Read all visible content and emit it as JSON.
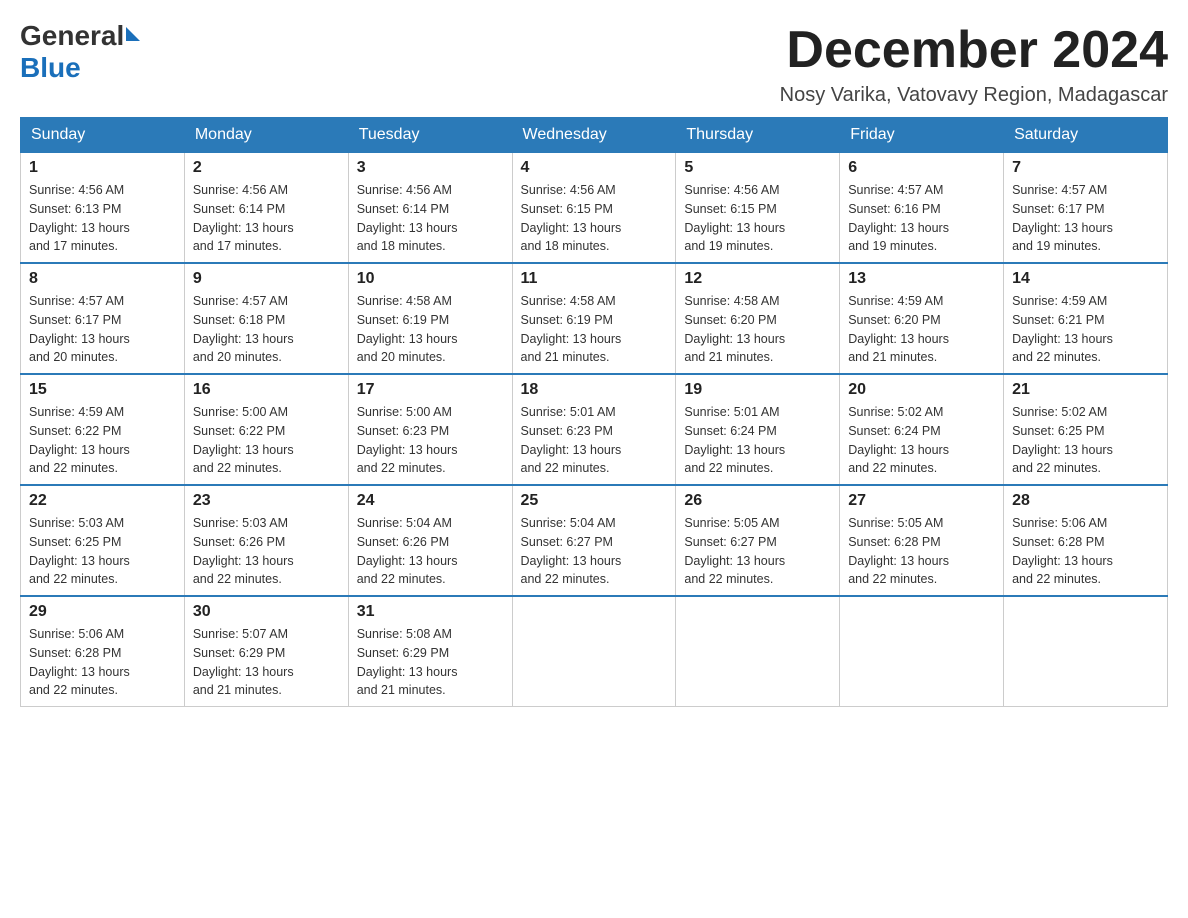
{
  "logo": {
    "general": "General",
    "blue": "Blue"
  },
  "title": {
    "month_year": "December 2024",
    "location": "Nosy Varika, Vatovavy Region, Madagascar"
  },
  "days_of_week": [
    "Sunday",
    "Monday",
    "Tuesday",
    "Wednesday",
    "Thursday",
    "Friday",
    "Saturday"
  ],
  "weeks": [
    [
      {
        "day": "1",
        "sunrise": "4:56 AM",
        "sunset": "6:13 PM",
        "daylight": "13 hours and 17 minutes."
      },
      {
        "day": "2",
        "sunrise": "4:56 AM",
        "sunset": "6:14 PM",
        "daylight": "13 hours and 17 minutes."
      },
      {
        "day": "3",
        "sunrise": "4:56 AM",
        "sunset": "6:14 PM",
        "daylight": "13 hours and 18 minutes."
      },
      {
        "day": "4",
        "sunrise": "4:56 AM",
        "sunset": "6:15 PM",
        "daylight": "13 hours and 18 minutes."
      },
      {
        "day": "5",
        "sunrise": "4:56 AM",
        "sunset": "6:15 PM",
        "daylight": "13 hours and 19 minutes."
      },
      {
        "day": "6",
        "sunrise": "4:57 AM",
        "sunset": "6:16 PM",
        "daylight": "13 hours and 19 minutes."
      },
      {
        "day": "7",
        "sunrise": "4:57 AM",
        "sunset": "6:17 PM",
        "daylight": "13 hours and 19 minutes."
      }
    ],
    [
      {
        "day": "8",
        "sunrise": "4:57 AM",
        "sunset": "6:17 PM",
        "daylight": "13 hours and 20 minutes."
      },
      {
        "day": "9",
        "sunrise": "4:57 AM",
        "sunset": "6:18 PM",
        "daylight": "13 hours and 20 minutes."
      },
      {
        "day": "10",
        "sunrise": "4:58 AM",
        "sunset": "6:19 PM",
        "daylight": "13 hours and 20 minutes."
      },
      {
        "day": "11",
        "sunrise": "4:58 AM",
        "sunset": "6:19 PM",
        "daylight": "13 hours and 21 minutes."
      },
      {
        "day": "12",
        "sunrise": "4:58 AM",
        "sunset": "6:20 PM",
        "daylight": "13 hours and 21 minutes."
      },
      {
        "day": "13",
        "sunrise": "4:59 AM",
        "sunset": "6:20 PM",
        "daylight": "13 hours and 21 minutes."
      },
      {
        "day": "14",
        "sunrise": "4:59 AM",
        "sunset": "6:21 PM",
        "daylight": "13 hours and 22 minutes."
      }
    ],
    [
      {
        "day": "15",
        "sunrise": "4:59 AM",
        "sunset": "6:22 PM",
        "daylight": "13 hours and 22 minutes."
      },
      {
        "day": "16",
        "sunrise": "5:00 AM",
        "sunset": "6:22 PM",
        "daylight": "13 hours and 22 minutes."
      },
      {
        "day": "17",
        "sunrise": "5:00 AM",
        "sunset": "6:23 PM",
        "daylight": "13 hours and 22 minutes."
      },
      {
        "day": "18",
        "sunrise": "5:01 AM",
        "sunset": "6:23 PM",
        "daylight": "13 hours and 22 minutes."
      },
      {
        "day": "19",
        "sunrise": "5:01 AM",
        "sunset": "6:24 PM",
        "daylight": "13 hours and 22 minutes."
      },
      {
        "day": "20",
        "sunrise": "5:02 AM",
        "sunset": "6:24 PM",
        "daylight": "13 hours and 22 minutes."
      },
      {
        "day": "21",
        "sunrise": "5:02 AM",
        "sunset": "6:25 PM",
        "daylight": "13 hours and 22 minutes."
      }
    ],
    [
      {
        "day": "22",
        "sunrise": "5:03 AM",
        "sunset": "6:25 PM",
        "daylight": "13 hours and 22 minutes."
      },
      {
        "day": "23",
        "sunrise": "5:03 AM",
        "sunset": "6:26 PM",
        "daylight": "13 hours and 22 minutes."
      },
      {
        "day": "24",
        "sunrise": "5:04 AM",
        "sunset": "6:26 PM",
        "daylight": "13 hours and 22 minutes."
      },
      {
        "day": "25",
        "sunrise": "5:04 AM",
        "sunset": "6:27 PM",
        "daylight": "13 hours and 22 minutes."
      },
      {
        "day": "26",
        "sunrise": "5:05 AM",
        "sunset": "6:27 PM",
        "daylight": "13 hours and 22 minutes."
      },
      {
        "day": "27",
        "sunrise": "5:05 AM",
        "sunset": "6:28 PM",
        "daylight": "13 hours and 22 minutes."
      },
      {
        "day": "28",
        "sunrise": "5:06 AM",
        "sunset": "6:28 PM",
        "daylight": "13 hours and 22 minutes."
      }
    ],
    [
      {
        "day": "29",
        "sunrise": "5:06 AM",
        "sunset": "6:28 PM",
        "daylight": "13 hours and 22 minutes."
      },
      {
        "day": "30",
        "sunrise": "5:07 AM",
        "sunset": "6:29 PM",
        "daylight": "13 hours and 21 minutes."
      },
      {
        "day": "31",
        "sunrise": "5:08 AM",
        "sunset": "6:29 PM",
        "daylight": "13 hours and 21 minutes."
      },
      null,
      null,
      null,
      null
    ]
  ],
  "labels": {
    "sunrise": "Sunrise:",
    "sunset": "Sunset:",
    "daylight": "Daylight:"
  }
}
